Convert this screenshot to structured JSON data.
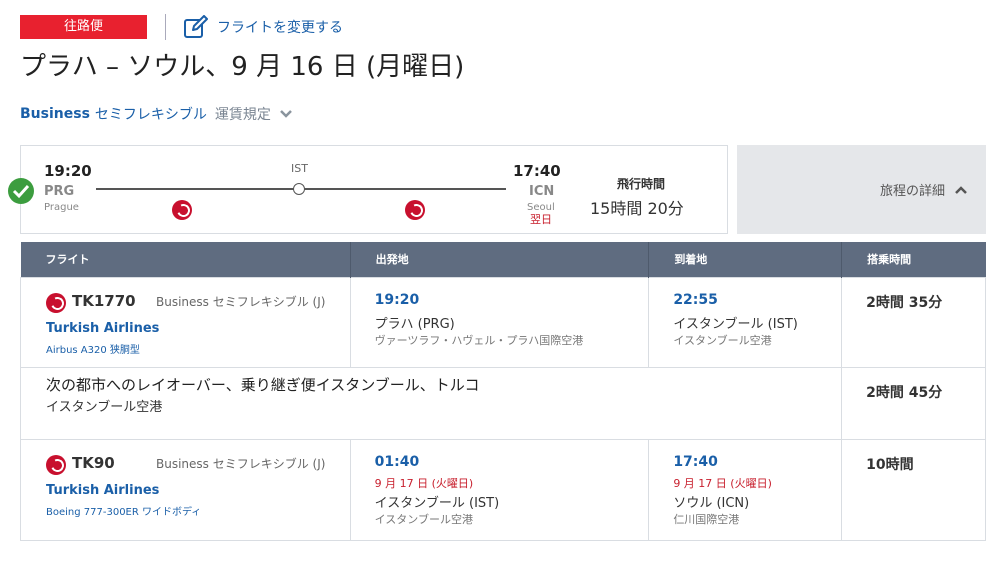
{
  "header": {
    "badge": "往路便",
    "change_flight": "フライトを変更する",
    "title": "プラハ – ソウル、9 月 16 日 (月曜日)",
    "fare_class": "Business",
    "fare_type": "セミフレキシブル",
    "fare_rules": "運賃規定"
  },
  "summary": {
    "dep_time": "19:20",
    "dep_code": "PRG",
    "dep_city": "Prague",
    "arr_time": "17:40",
    "arr_code": "ICN",
    "arr_city": "Seoul",
    "arr_nextday": "翌日",
    "stop": "IST",
    "duration_label": "飛行時間",
    "duration_value": "15時間 20分",
    "details_label": "旅程の詳細"
  },
  "table": {
    "headers": [
      "フライト",
      "出発地",
      "到着地",
      "搭乗時間"
    ],
    "segments": [
      {
        "flight": "TK1770",
        "class": "Business セミフレキシブル (J)",
        "airline": "Turkish Airlines",
        "aircraft": "Airbus A320 狭胴型",
        "dep_time": "19:20",
        "dep_city": "プラハ (PRG)",
        "dep_airport": "ヴァーツラフ・ハヴェル・プラハ国際空港",
        "arr_time": "22:55",
        "arr_city": "イスタンブール (IST)",
        "arr_airport": "イスタンブール空港",
        "duration": "2時間 35分"
      },
      {
        "flight": "TK90",
        "class": "Business セミフレキシブル (J)",
        "airline": "Turkish Airlines",
        "aircraft": "Boeing 777-300ER ワイドボディ",
        "dep_time": "01:40",
        "dep_date": "9 月 17 日 (火曜日)",
        "dep_city": "イスタンブール (IST)",
        "dep_airport": "イスタンブール空港",
        "arr_time": "17:40",
        "arr_date": "9 月 17 日 (火曜日)",
        "arr_city": "ソウル (ICN)",
        "arr_airport": "仁川国際空港",
        "duration": "10時間"
      }
    ],
    "layover": {
      "title": "次の都市へのレイオーバー、乗り継ぎ便イスタンブール、トルコ",
      "airport": "イスタンブール空港",
      "duration": "2時間 45分"
    }
  },
  "colors": {
    "brand_red": "#e8212f",
    "link_blue": "#1a5fa8",
    "header_gray": "#5f6c80",
    "check_green": "#3c9d3f"
  },
  "icons": [
    "edit-icon",
    "chevron-down-icon",
    "chevron-up-icon",
    "check-circle-icon",
    "turkish-airlines-logo"
  ]
}
